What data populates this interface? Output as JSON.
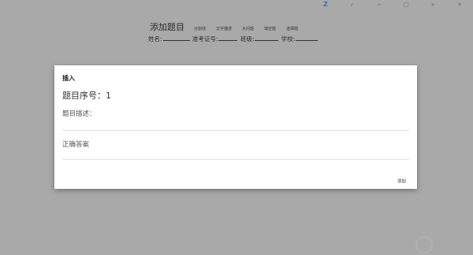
{
  "window": {
    "logo": "Z",
    "controls": [
      "✓",
      "−",
      "□",
      "+",
      "✕"
    ]
  },
  "exam": {
    "title": "添加题目",
    "toolbar": [
      "分割线",
      "文字描述",
      "大问题",
      "填空题",
      "选择题"
    ],
    "fields": {
      "name_label": "姓名:",
      "exam_id_label": "准考证号:",
      "class_label": "班级:",
      "school_label": "学校:"
    }
  },
  "modal": {
    "title": "插入",
    "question_number": "题目序号：1",
    "description_label": "题目描述：",
    "description_value": "",
    "answer_label": "正确答案",
    "answer_value": "",
    "add_label": "添加"
  }
}
